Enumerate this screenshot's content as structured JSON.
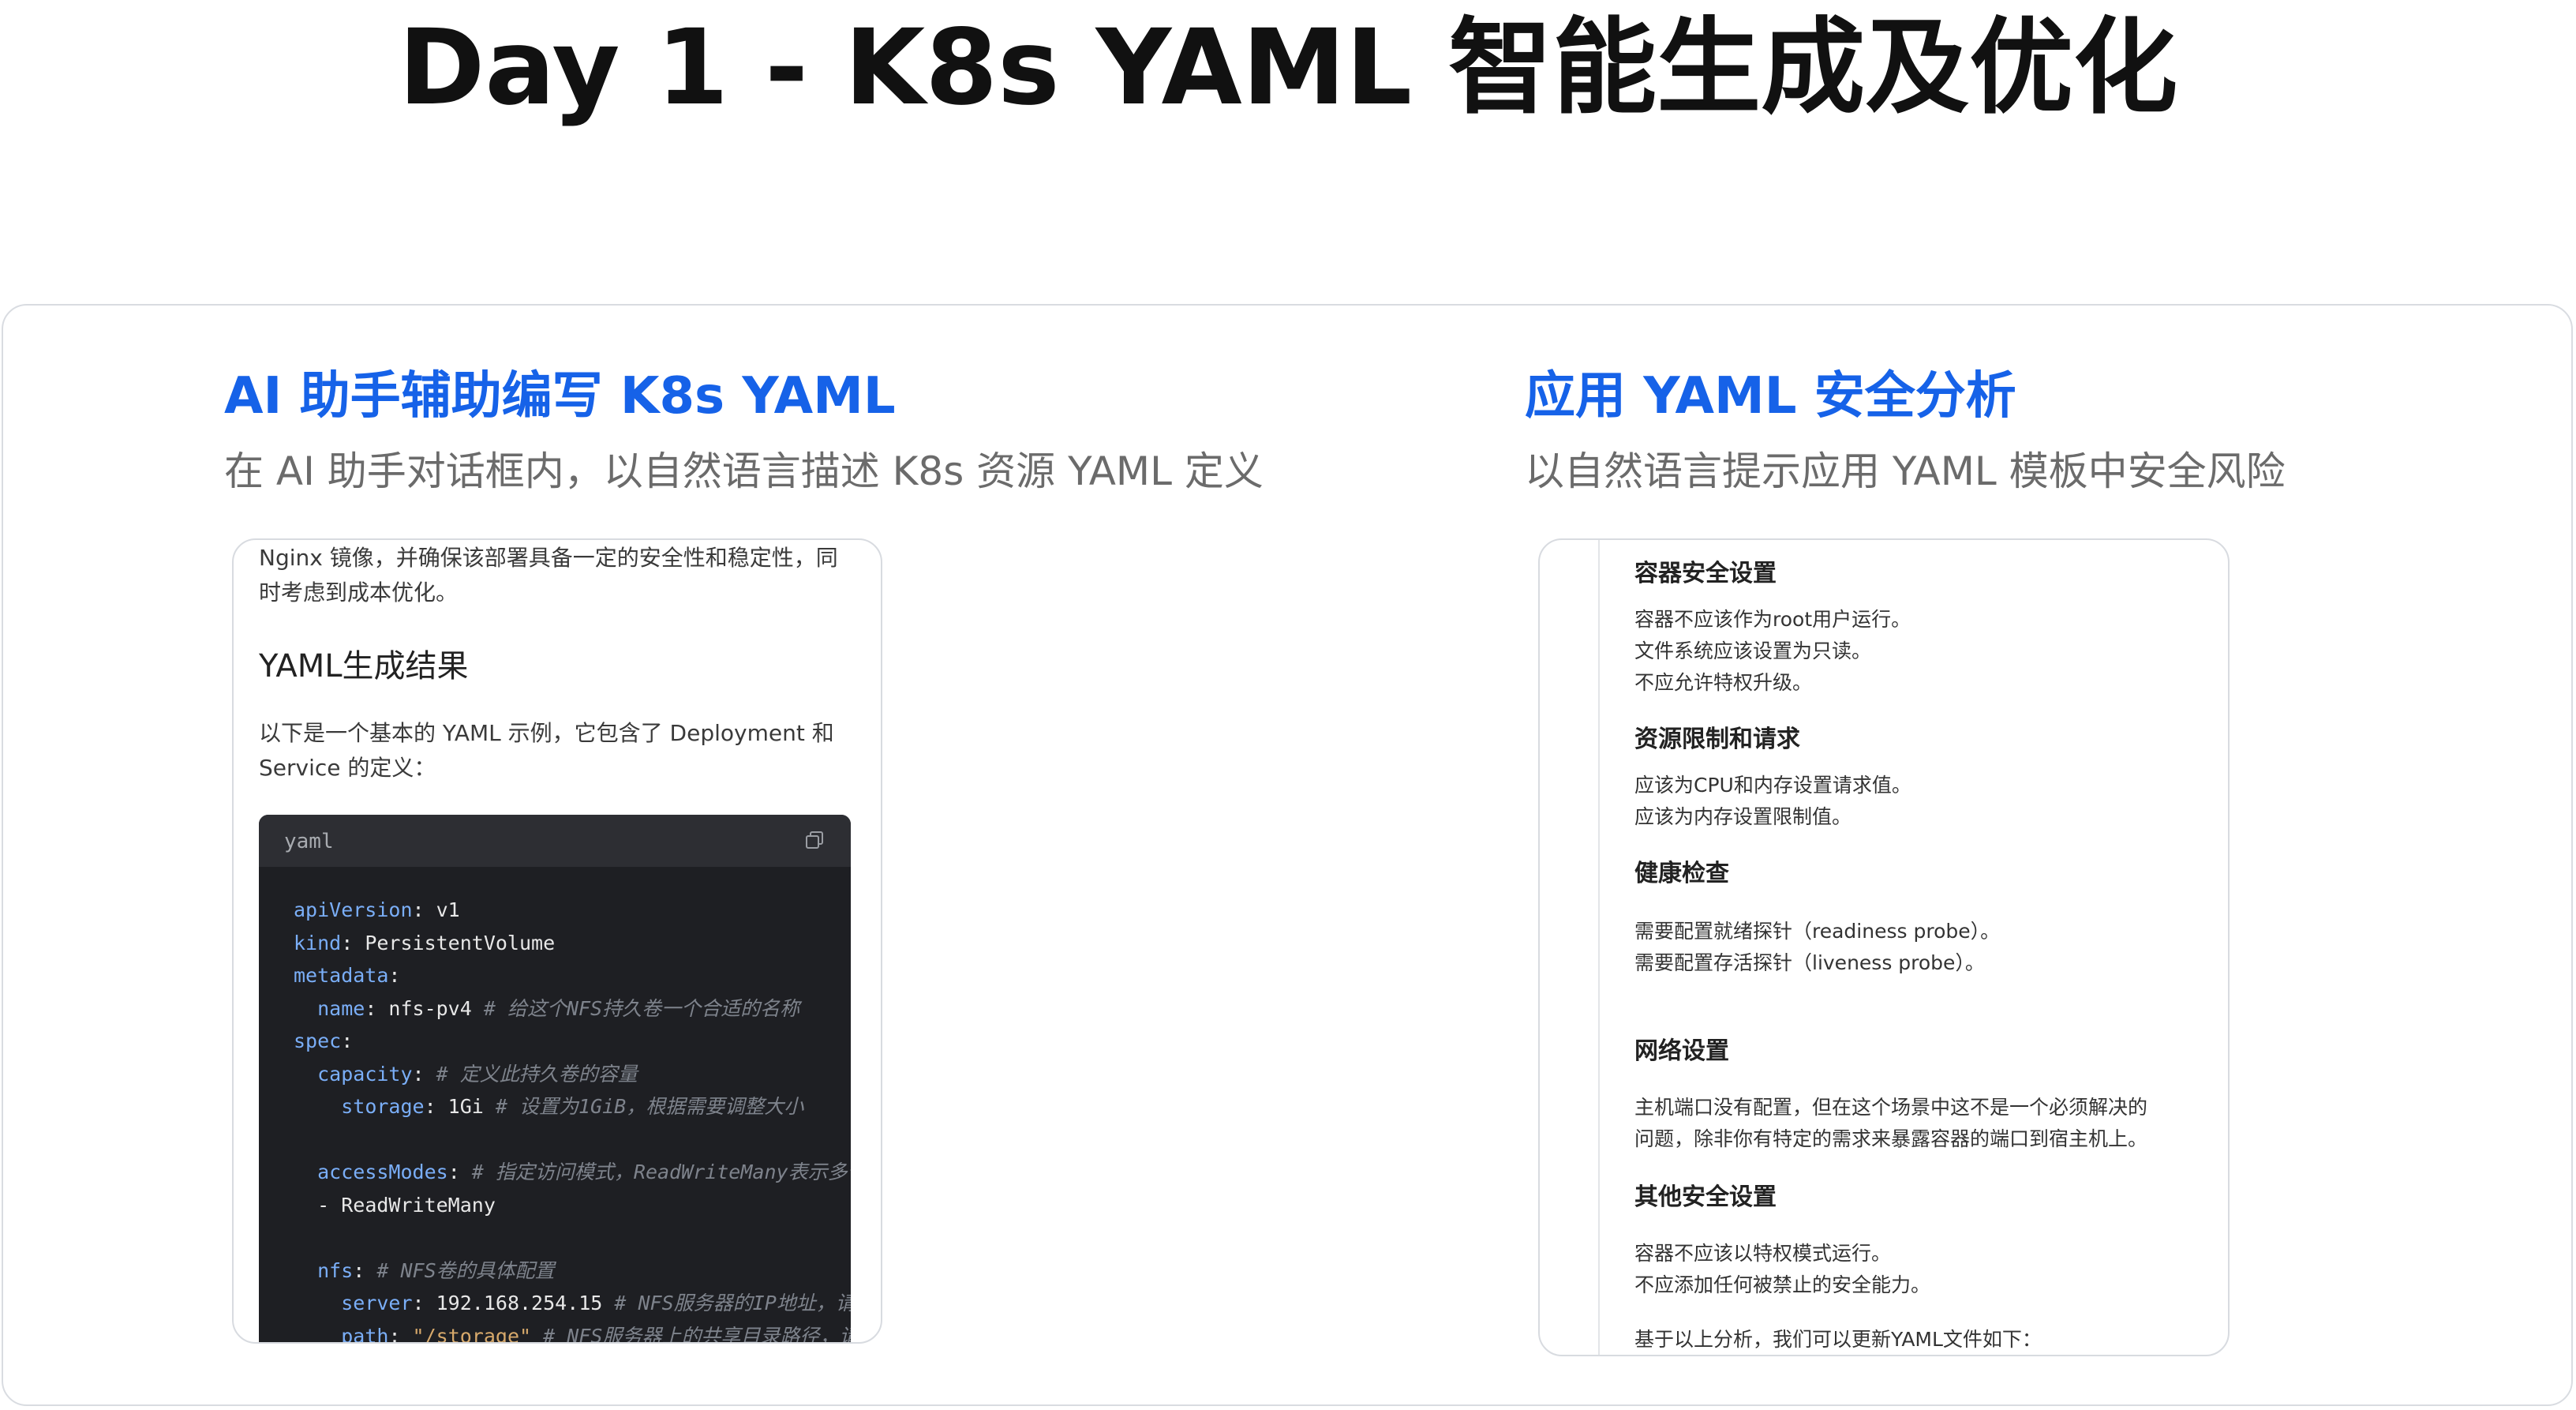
{
  "title": "Day 1 - K8s YAML 智能生成及优化",
  "left": {
    "heading": "AI 助手辅助编写 K8s YAML",
    "subheading": "在 AI 助手对话框内，以自然语言描述 K8s 资源 YAML 定义",
    "chat_line1": "Nginx 镜像，并确保该部署具备一定的安全性和稳定性，同",
    "chat_line2": "时考虑到成本优化。",
    "result_heading": "YAML生成结果",
    "result_line1": "以下是一个基本的 YAML 示例，它包含了 Deployment 和",
    "result_line2": "Service 的定义：",
    "code_lang": "yaml",
    "code": {
      "l1k": "apiVersion",
      "l1v": ": v1",
      "l2k": "kind",
      "l2v": ": PersistentVolume",
      "l3k": "metadata",
      "l3v": ":",
      "l4k": "name",
      "l4v": ": nfs-pv4 ",
      "l4c": "# 给这个NFS持久卷一个合适的名称",
      "l5k": "spec",
      "l5v": ":",
      "l6k": "capacity",
      "l6v": ": ",
      "l6c": "# 定义此持久卷的容量",
      "l7k": "storage",
      "l7v": ": 1Gi ",
      "l7c": "# 设置为1GiB，根据需要调整大小",
      "l8k": "accessModes",
      "l8v": ": ",
      "l8c": "# 指定访问模式，ReadWriteMany表示多个",
      "l9v": "- ReadWriteMany",
      "l10k": "nfs",
      "l10v": ": ",
      "l10c": "# NFS卷的具体配置",
      "l11k": "server",
      "l11v": ": 192.168.254.15 ",
      "l11c": "# NFS服务器的IP地址，请替",
      "l12k": "path",
      "l12v": ": ",
      "l12s": "\"/storage\"",
      "l12c": " # NFS服务器上的共享目录路径，请替"
    }
  },
  "right": {
    "heading": "应用 YAML 安全分析",
    "subheading": "以自然语言提示应用 YAML 模板中安全风险",
    "sections": [
      {
        "title": "容器安全设置",
        "lines": [
          "容器不应该作为root用户运行。",
          "文件系统应该设置为只读。",
          "不应允许特权升级。"
        ]
      },
      {
        "title": "资源限制和请求",
        "lines": [
          "应该为CPU和内存设置请求值。",
          "应该为内存设置限制值。"
        ]
      },
      {
        "title": "健康检查",
        "lines": [
          "需要配置就绪探针（readiness probe）。",
          "需要配置存活探针（liveness probe）。"
        ]
      },
      {
        "title": "网络设置",
        "lines": [
          "主机端口没有配置，但在这个场景中这不是一个必须解决的",
          "问题，除非你有特定的需求来暴露容器的端口到宿主机上。"
        ]
      },
      {
        "title": "其他安全设置",
        "lines": [
          "容器不应该以特权模式运行。",
          "不应添加任何被禁止的安全能力。"
        ]
      }
    ],
    "footer": "基于以上分析，我们可以更新YAML文件如下："
  }
}
